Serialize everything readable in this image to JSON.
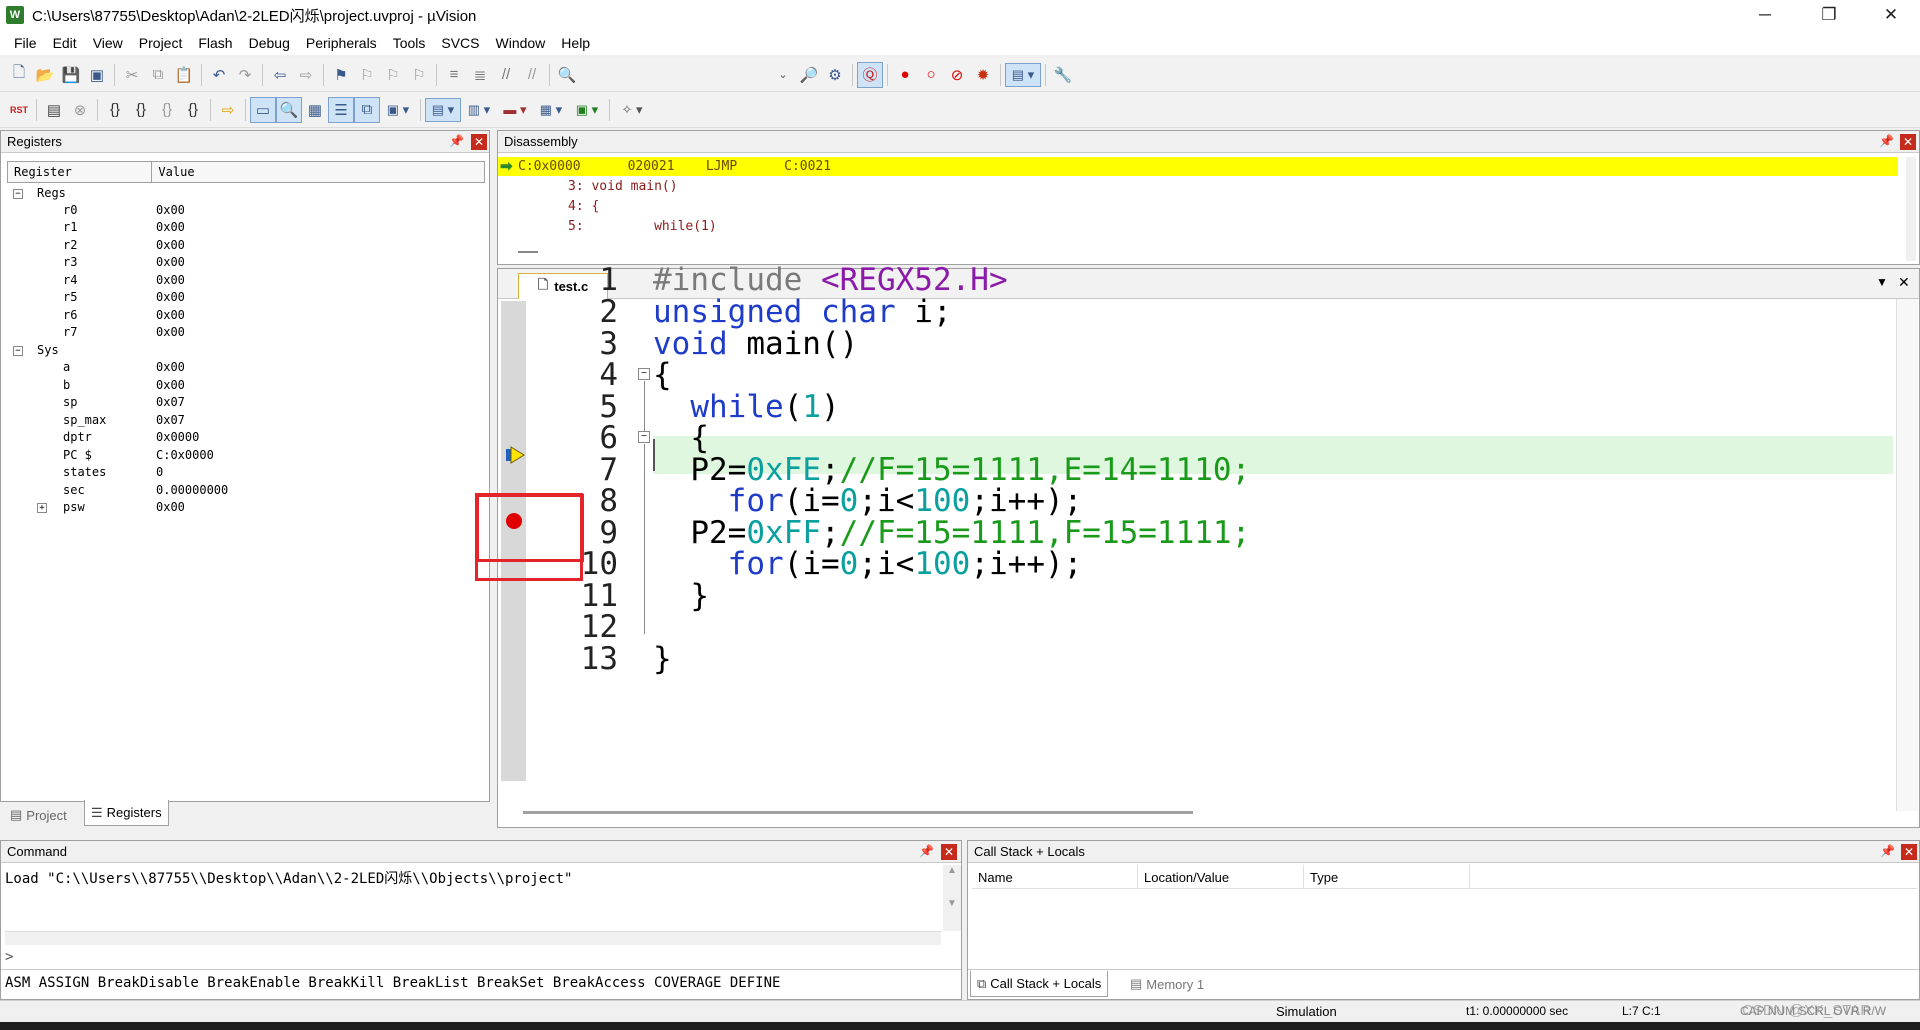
{
  "window": {
    "title": "C:\\Users\\87755\\Desktop\\Adan\\2-2LED闪烁\\project.uvproj - µVision",
    "app_icon": "W",
    "controls": {
      "minimize": "─",
      "maximize": "❐",
      "close": "✕"
    }
  },
  "menu": [
    "File",
    "Edit",
    "View",
    "Project",
    "Flash",
    "Debug",
    "Peripherals",
    "Tools",
    "SVCS",
    "Window",
    "Help"
  ],
  "toolbar1_icons": [
    "new-file-icon",
    "open-folder-icon",
    "save-icon",
    "save-all-icon",
    "cut-icon",
    "copy-icon",
    "paste-icon",
    "undo-icon",
    "redo-icon",
    "nav-back-icon",
    "nav-forward-icon",
    "bookmark-icon",
    "bookmark-prev-icon",
    "bookmark-next-icon",
    "bookmark-clear-icon",
    "indent-icon",
    "unindent-icon",
    "comment-icon",
    "uncomment-icon",
    "find-in-files-icon",
    "find-combo-dropdown",
    "incremental-find-icon",
    "configure-icon",
    "debug-session-icon",
    "breakpoint-insert-icon",
    "breakpoint-enable-icon",
    "breakpoint-disable-all-icon",
    "breakpoint-kill-all-icon",
    "window-layout-icon",
    "settings-wrench-icon"
  ],
  "toolbar2_icons": [
    "reset-cpu-icon",
    "run-icon",
    "stop-icon",
    "step-into-icon",
    "step-over-icon",
    "step-out-icon",
    "run-to-cursor-icon",
    "show-next-statement-icon",
    "command-window-icon",
    "disassembly-window-icon",
    "symbols-window-icon",
    "registers-window-icon",
    "call-stack-window-icon",
    "watch-windows-icon",
    "memory-windows-icon",
    "serial-windows-icon",
    "analysis-windows-icon",
    "trace-windows-icon",
    "system-viewer-icon",
    "toolbox-icon"
  ],
  "registers": {
    "title": "Registers",
    "col_register": "Register",
    "col_value": "Value",
    "groups": [
      {
        "name": "Regs",
        "items": [
          {
            "name": "r0",
            "value": "0x00"
          },
          {
            "name": "r1",
            "value": "0x00"
          },
          {
            "name": "r2",
            "value": "0x00"
          },
          {
            "name": "r3",
            "value": "0x00"
          },
          {
            "name": "r4",
            "value": "0x00"
          },
          {
            "name": "r5",
            "value": "0x00"
          },
          {
            "name": "r6",
            "value": "0x00"
          },
          {
            "name": "r7",
            "value": "0x00"
          }
        ]
      },
      {
        "name": "Sys",
        "items": [
          {
            "name": "a",
            "value": "0x00"
          },
          {
            "name": "b",
            "value": "0x00"
          },
          {
            "name": "sp",
            "value": "0x07"
          },
          {
            "name": "sp_max",
            "value": "0x07"
          },
          {
            "name": "dptr",
            "value": "0x0000"
          },
          {
            "name": "PC  $",
            "value": "C:0x0000"
          },
          {
            "name": "states",
            "value": "0"
          },
          {
            "name": "sec",
            "value": "0.00000000"
          },
          {
            "name": "psw",
            "value": "0x00"
          }
        ]
      }
    ],
    "tabs": [
      "Project",
      "Registers"
    ]
  },
  "disassembly": {
    "title": "Disassembly",
    "current": "C:0x0000      020021    LJMP      C:0021",
    "lines": [
      "3: void main()",
      "4: {",
      "5:         while(1)"
    ]
  },
  "editor": {
    "tab": "test.c",
    "lines": [
      {
        "n": "1"
      },
      {
        "n": "2"
      },
      {
        "n": "3"
      },
      {
        "n": "4"
      },
      {
        "n": "5"
      },
      {
        "n": "6"
      },
      {
        "n": "7"
      },
      {
        "n": "8"
      },
      {
        "n": "9"
      },
      {
        "n": "10"
      },
      {
        "n": "11"
      },
      {
        "n": "12"
      },
      {
        "n": "13"
      }
    ],
    "code": {
      "l1_pp": "#include",
      "l1_inc": " <REGX52.H>",
      "l2_kw": "unsigned char",
      "l2_rest": " i;",
      "l3_kw": "void",
      "l3_rest": " main()",
      "l4": "{",
      "l5_kw": "  while",
      "l5_a": "(",
      "l5_num": "1",
      "l5_b": ")",
      "l6": "  {",
      "l7_a": "  P2=",
      "l7_num": "0xFE",
      "l7_b": ";",
      "l7_cm": "//F=15=1111,E=14=1110;",
      "l8_kw": "    for",
      "l8_a": "(i=",
      "l8_n1": "0",
      "l8_b": ";i<",
      "l8_n2": "100",
      "l8_c": ";i++);",
      "l9_a": "  P2=",
      "l9_num": "0xFF",
      "l9_b": ";",
      "l9_cm": "//F=15=1111,F=15=1111;",
      "l10_kw": "    for",
      "l10_a": "(i=",
      "l10_n1": "0",
      "l10_b": ";i<",
      "l10_n2": "100",
      "l10_c": ";i++);",
      "l11": "  }",
      "l12": "",
      "l13": "}"
    },
    "current_line": "7",
    "breakpoint_line": "9"
  },
  "command": {
    "title": "Command",
    "output": "Load \"C:\\\\Users\\\\87755\\\\Desktop\\\\Adan\\\\2-2LED闪烁\\\\Objects\\\\project\"",
    "prompt": ">",
    "hints": "ASM ASSIGN BreakDisable BreakEnable BreakKill BreakList BreakSet BreakAccess COVERAGE DEFINE"
  },
  "callstack": {
    "title": "Call Stack + Locals",
    "columns": [
      "Name",
      "Location/Value",
      "Type"
    ],
    "tabs": [
      "Call Stack + Locals",
      "Memory 1"
    ]
  },
  "status": {
    "mode": "Simulation",
    "time": "t1: 0.00000000 sec",
    "position": "L:7 C:1",
    "indicators": "CAP  NUM  SCRL  OVR  R/W",
    "watermark": "CSDN @XK_STAR"
  },
  "colors": {
    "current_pc_highlight": "#ffff00",
    "current_line_highlight": "#dff7df",
    "breakpoint": "#e00000",
    "annotation_box": "#e3242b"
  }
}
